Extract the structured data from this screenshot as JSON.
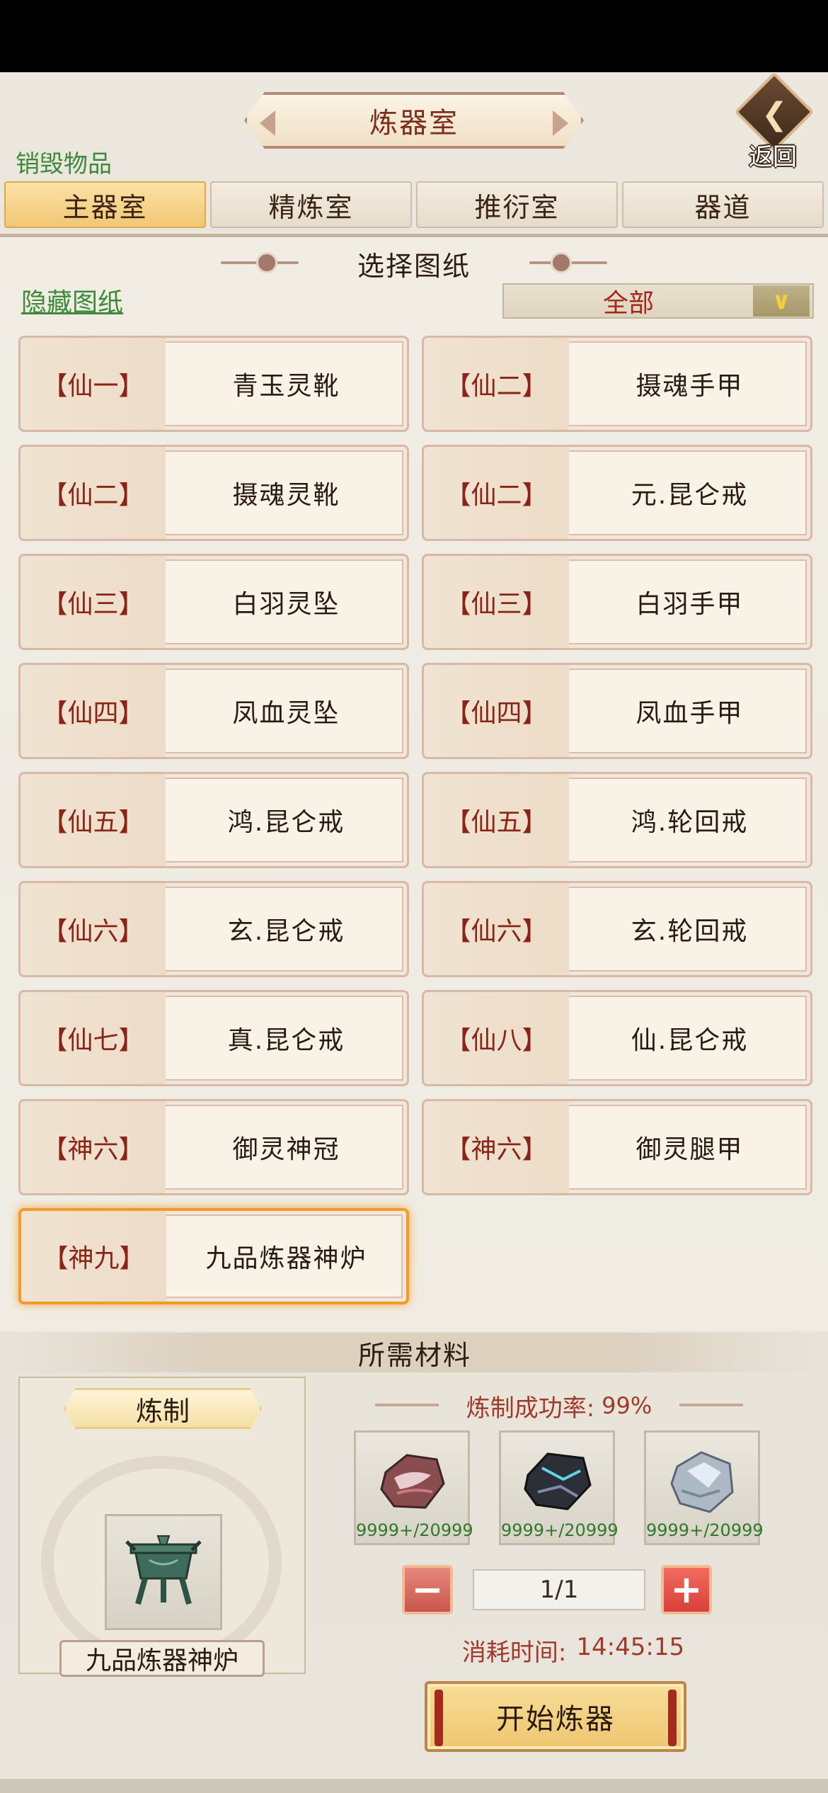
{
  "header": {
    "title": "炼器室",
    "back_label": "返回",
    "destroy_link": "销毁物品"
  },
  "tabs": [
    {
      "label": "主器室",
      "active": true
    },
    {
      "label": "精炼室",
      "active": false
    },
    {
      "label": "推衍室",
      "active": false
    },
    {
      "label": "器道",
      "active": false
    }
  ],
  "blueprints": {
    "section_title": "选择图纸",
    "hide_link": "隐藏图纸",
    "filter_value": "全部",
    "items": [
      {
        "tier": "【仙一】",
        "name": "青玉灵靴"
      },
      {
        "tier": "【仙二】",
        "name": "摄魂手甲"
      },
      {
        "tier": "【仙二】",
        "name": "摄魂灵靴"
      },
      {
        "tier": "【仙二】",
        "name": "元.昆仑戒"
      },
      {
        "tier": "【仙三】",
        "name": "白羽灵坠"
      },
      {
        "tier": "【仙三】",
        "name": "白羽手甲"
      },
      {
        "tier": "【仙四】",
        "name": "凤血灵坠"
      },
      {
        "tier": "【仙四】",
        "name": "凤血手甲"
      },
      {
        "tier": "【仙五】",
        "name": "鸿.昆仑戒"
      },
      {
        "tier": "【仙五】",
        "name": "鸿.轮回戒"
      },
      {
        "tier": "【仙六】",
        "name": "玄.昆仑戒"
      },
      {
        "tier": "【仙六】",
        "name": "玄.轮回戒"
      },
      {
        "tier": "【仙七】",
        "name": "真.昆仑戒"
      },
      {
        "tier": "【仙八】",
        "name": "仙.昆仑戒"
      },
      {
        "tier": "【神六】",
        "name": "御灵神冠"
      },
      {
        "tier": "【神六】",
        "name": "御灵腿甲"
      },
      {
        "tier": "【神九】",
        "name": "九品炼器神炉",
        "selected": true
      }
    ]
  },
  "materials": {
    "section_title": "所需材料",
    "craft_label": "炼制",
    "craft_item_icon": "bronze-cauldron-icon",
    "craft_item_name": "九品炼器神炉",
    "success_rate_label": "炼制成功率:",
    "success_rate_value": "99%",
    "items": [
      {
        "icon": "red-ore-icon",
        "count": "9999+/20999"
      },
      {
        "icon": "dark-crystal-ore-icon",
        "count": "9999+/20999"
      },
      {
        "icon": "silver-ore-icon",
        "count": "9999+/20999"
      }
    ],
    "quantity": "1/1",
    "time_label": "消耗时间:",
    "time_value": "14:45:15",
    "start_button": "开始炼器"
  },
  "colors": {
    "accent_green": "#3d8a3a",
    "accent_red": "#a0281c",
    "tab_active": "#f1c774",
    "selected_border": "#f39a2c"
  }
}
